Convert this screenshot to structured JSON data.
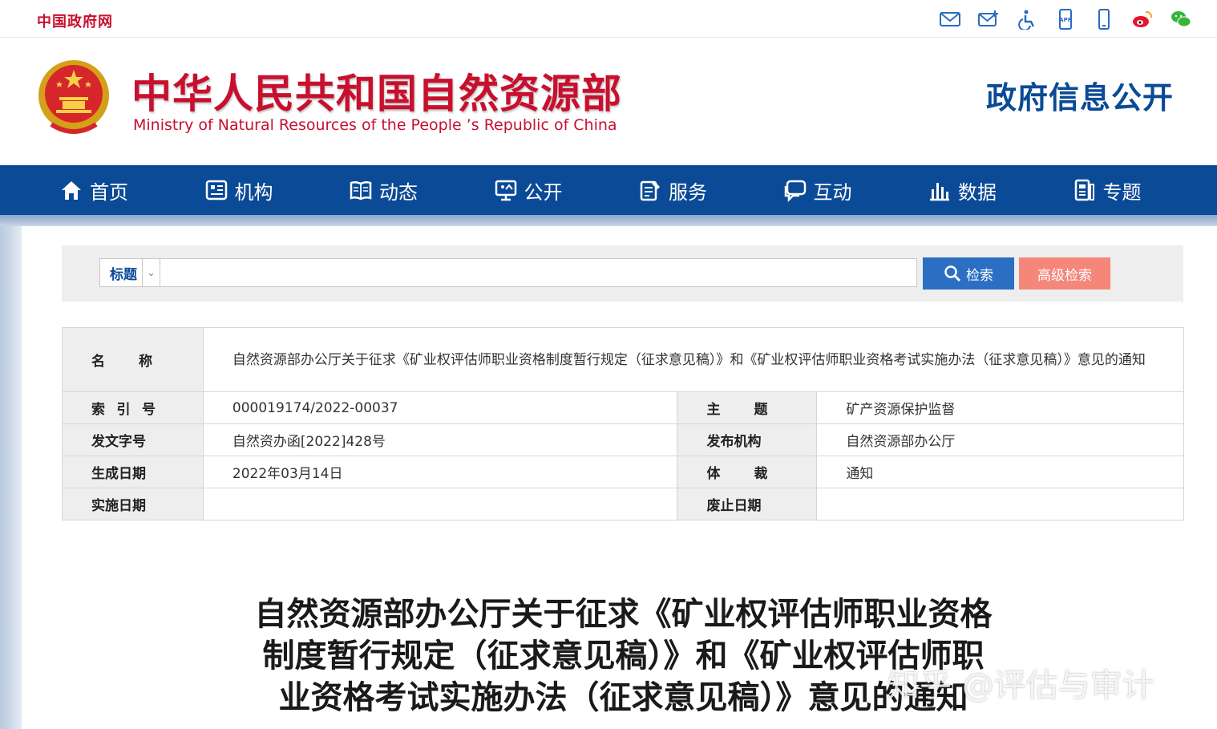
{
  "topbar": {
    "gov_link": "中国政府网",
    "icons": [
      "mail-icon",
      "mail-plus-icon",
      "accessibility-icon",
      "app-icon",
      "mobile-icon",
      "weibo-icon",
      "wechat-icon"
    ]
  },
  "header": {
    "title": "中华人民共和国自然资源部",
    "subtitle": "Ministry of Natural Resources of the People ’s Republic of China",
    "section": "政府信息公开"
  },
  "nav": {
    "items": [
      {
        "label": "首页",
        "icon": "home-icon"
      },
      {
        "label": "机构",
        "icon": "org-icon"
      },
      {
        "label": "动态",
        "icon": "book-icon"
      },
      {
        "label": "公开",
        "icon": "monitor-icon"
      },
      {
        "label": "服务",
        "icon": "service-icon"
      },
      {
        "label": "互动",
        "icon": "chat-icon"
      },
      {
        "label": "数据",
        "icon": "chart-icon"
      },
      {
        "label": "专题",
        "icon": "topic-icon"
      }
    ]
  },
  "search": {
    "select_value": "标题",
    "input_value": "",
    "search_label": "检索",
    "advanced_label": "高级检索"
  },
  "meta": {
    "name_label": [
      "名",
      "称"
    ],
    "name_value": "自然资源部办公厅关于征求《矿业权评估师职业资格制度暂行规定（征求意见稿）》和《矿业权评估师职业资格考试实施办法（征求意见稿）》意见的通知",
    "index_label": [
      "索",
      "引",
      "号"
    ],
    "index_value": "000019174/2022-00037",
    "topic_label": [
      "主",
      "题"
    ],
    "topic_value": "矿产资源保护监督",
    "doc_no_label": "发文字号",
    "doc_no_value": "自然资办函[2022]428号",
    "issuer_label": "发布机构",
    "issuer_value": "自然资源部办公厅",
    "created_label": "生成日期",
    "created_value": "2022年03月14日",
    "genre_label": [
      "体",
      "裁"
    ],
    "genre_value": "通知",
    "effective_label": "实施日期",
    "effective_value": "",
    "expire_label": "废止日期",
    "expire_value": ""
  },
  "document": {
    "title_lines": [
      "自然资源部办公厅关于征求《矿业权评估师职业资格",
      "制度暂行规定（征求意见稿）》和《矿业权评估师职",
      "业资格考试实施办法（征求意见稿）》意见的通知"
    ]
  },
  "watermark": "知乎 @评估与审计",
  "colors": {
    "brand_red": "#c8102e",
    "nav_blue": "#0b4a96",
    "search_blue": "#2b6fc2",
    "advanced_coral": "#f4877a"
  }
}
